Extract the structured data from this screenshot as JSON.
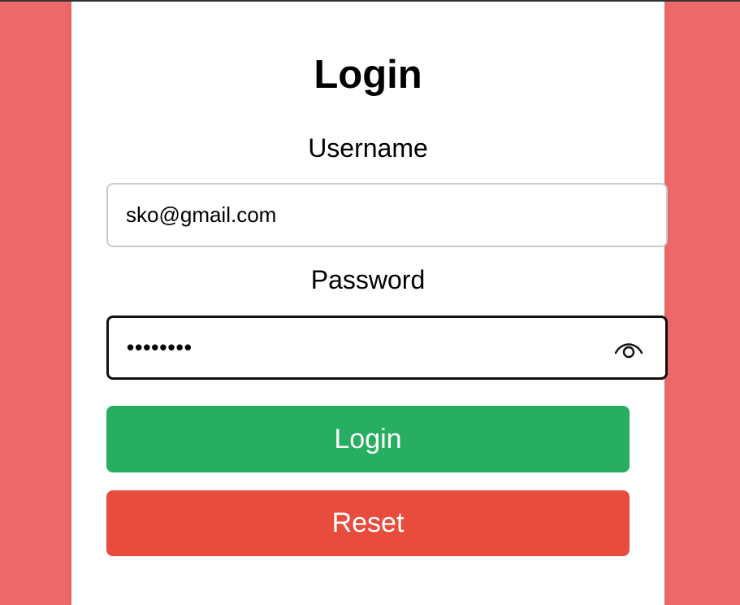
{
  "form": {
    "title": "Login",
    "username_label": "Username",
    "username_value": "sko@gmail.com",
    "password_label": "Password",
    "password_masked": "••••••••",
    "login_button": "Login",
    "reset_button": "Reset"
  },
  "icons": {
    "password_toggle": "eye-icon"
  },
  "colors": {
    "background": "#ee6969",
    "card": "#ffffff",
    "login_button": "#27ae60",
    "reset_button": "#e74c3c",
    "focused_border": "#111111",
    "input_border": "#cccccc"
  }
}
